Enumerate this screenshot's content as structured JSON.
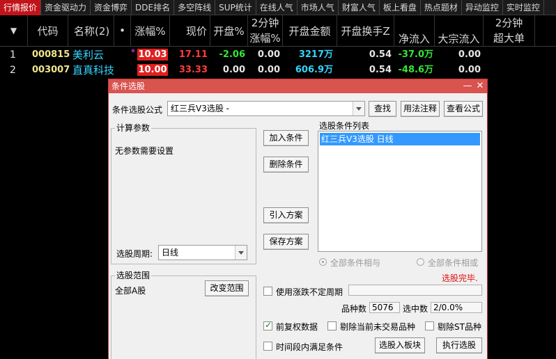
{
  "tabs": [
    "行情报价",
    "资金驱动力",
    "资金博弈",
    "DDE排名",
    "多空阵线",
    "SUP统计",
    "在线人气",
    "市场人气",
    "财富人气",
    "板上看盘",
    "热点题材",
    "异动监控",
    "实时监控"
  ],
  "headers": {
    "sort": "▼",
    "code": "代码",
    "name": "名称(2)",
    "dot": "•",
    "change": "涨幅%",
    "price": "现价",
    "open": "开盘%",
    "change2_top": "2分钟",
    "change2_bot": "涨幅%",
    "open_amount": "开盘金额",
    "open_turnover": "开盘换手Z",
    "net_inflow": "净流入",
    "block_inflow": "大宗流入",
    "super_top": "2分钟",
    "super_bot": "超大单"
  },
  "rows": [
    {
      "no": "1",
      "code": "000815",
      "name": "美利云",
      "mark": "*",
      "change": "10.03",
      "price": "17.11",
      "open": "-2.06",
      "change2": "0.00",
      "amount": "3217万",
      "turnover": "0.54",
      "net": "-37.0万",
      "block": "0.00"
    },
    {
      "no": "2",
      "code": "003007",
      "name": "直真科技",
      "mark": "",
      "change": "10.00",
      "price": "33.33",
      "open": "0.00",
      "change2": "0.00",
      "amount": "606.9万",
      "turnover": "0.54",
      "net": "-48.6万",
      "block": "0.00"
    }
  ],
  "dialog": {
    "title": "条件选股",
    "minimize": "—",
    "close": "✕",
    "formula_label": "条件选股公式",
    "formula_value": "红三兵V3选股 -",
    "find": "查找",
    "usage": "用法注释",
    "view_formula": "查看公式",
    "params_title": "计算参数",
    "params_text": "无参数需要设置",
    "add_condition": "加入条件",
    "delete_condition": "删除条件",
    "import_plan": "引入方案",
    "save_plan": "保存方案",
    "list_title": "选股条件列表",
    "list_item": "红三兵V3选股  日线",
    "and_label": "全部条件相与",
    "or_label": "全部条件相或",
    "status": "选股完毕.",
    "period_label": "选股周期:",
    "period_value": "日线",
    "range_title": "选股范围",
    "range_value": "全部A股",
    "change_range": "改变范围",
    "use_period": "使用涨跌不定周期",
    "count_label": "品种数",
    "count_value": "5076",
    "selected_label": "选中数",
    "selected_value": "2/0.0%",
    "fq_label": "前复权数据",
    "exclude_untraded": "剔除当前未交易品种",
    "exclude_st": "剔除ST品种",
    "time_label": "时间段内满足条件",
    "to_block": "选股入板块",
    "execute": "执行选股"
  }
}
